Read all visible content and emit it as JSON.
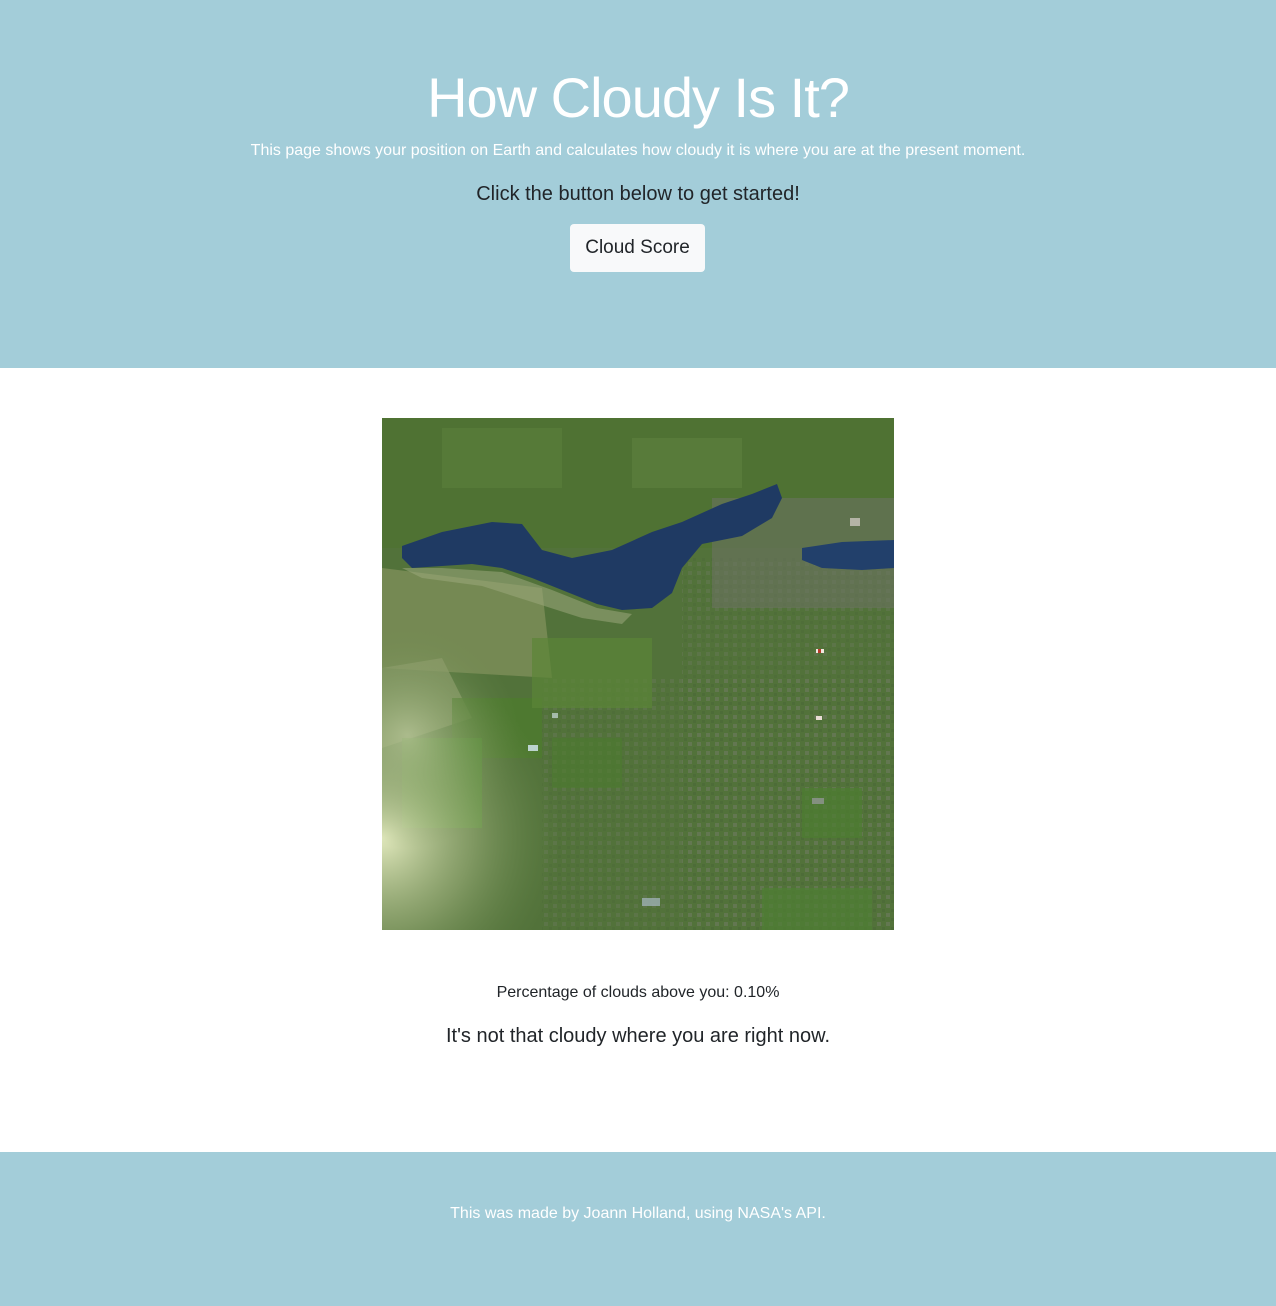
{
  "header": {
    "title": "How Cloudy Is It?",
    "description": "This page shows your position on Earth and calculates how cloudy it is where you are at the present moment.",
    "call_to_action": "Click the button below to get started!",
    "button_label": "Cloud Score",
    "background_color": "#a3cdd9"
  },
  "result": {
    "percentage_text": "Percentage of clouds above you: 0.10%",
    "verdict": "It's not that cloudy where you are right now."
  },
  "footer": {
    "credit": "This was made by Joann Holland, using NASA's API."
  }
}
